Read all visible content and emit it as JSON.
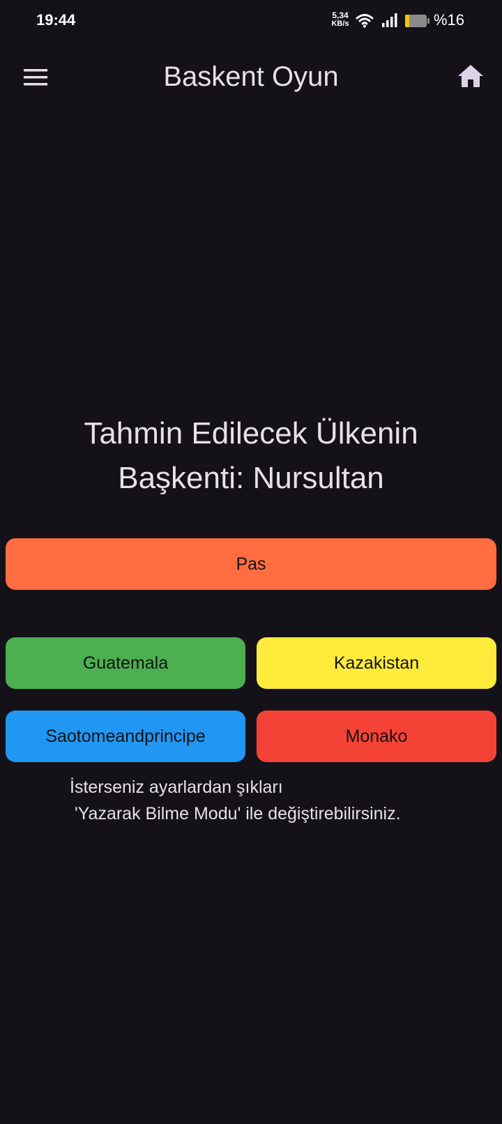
{
  "status_bar": {
    "time": "19:44",
    "net_speed_value": "5,34",
    "net_speed_unit": "KB/s",
    "battery_percent": "%16",
    "battery_level": 0.16,
    "icons": [
      "wifi-icon",
      "signal-icon",
      "battery-icon"
    ]
  },
  "app_bar": {
    "title": "Baskent Oyun",
    "menu_icon": "menu-icon",
    "home_icon": "home-icon"
  },
  "question": {
    "line1": "Tahmin Edilecek Ülkenin",
    "line2": "Başkenti: Nursultan"
  },
  "pass_button": {
    "label": "Pas",
    "color": "#ff6d40"
  },
  "answers": [
    {
      "label": "Guatemala",
      "color": "#4caf50"
    },
    {
      "label": "Kazakistan",
      "color": "#ffeb3b"
    },
    {
      "label": "Saotomeandprincipe",
      "color": "#2196f3"
    },
    {
      "label": "Monako",
      "color": "#f44336"
    }
  ],
  "hint": {
    "line1": "İsterseniz ayarlardan şıkları",
    "line2": " 'Yazarak Bilme Modu' ile değiştirebilirsiniz."
  },
  "colors": {
    "background": "#141218",
    "text": "#e6e1e5",
    "icon": "#ddd3e8"
  }
}
